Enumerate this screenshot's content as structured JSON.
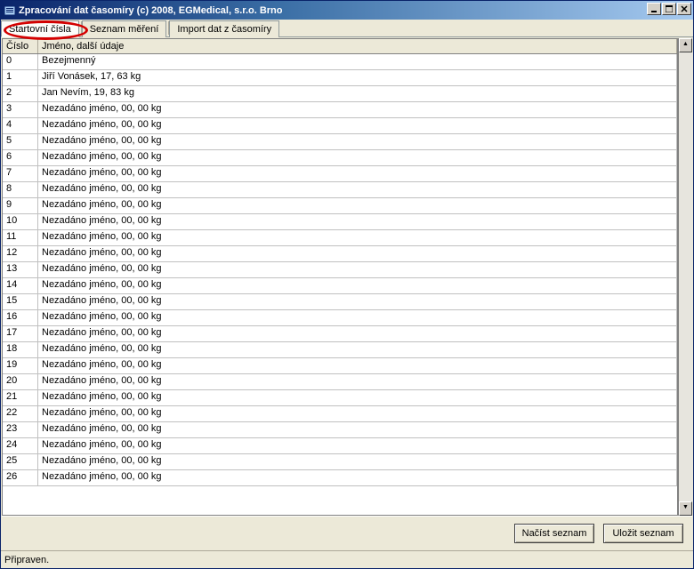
{
  "window": {
    "title": "Zpracování dat časomíry (c) 2008, EGMedical, s.r.o. Brno"
  },
  "tabs": [
    {
      "label": "Startovní čísla",
      "active": true
    },
    {
      "label": "Seznam měření",
      "active": false
    },
    {
      "label": "Import dat z časomíry",
      "active": false
    }
  ],
  "columns": [
    {
      "label": "Číslo"
    },
    {
      "label": "Jméno, další údaje"
    }
  ],
  "rows": [
    {
      "num": "0",
      "name": "Bezejmenný"
    },
    {
      "num": "1",
      "name": "Jiří Vonásek, 17, 63 kg"
    },
    {
      "num": "2",
      "name": "Jan Nevím, 19, 83 kg"
    },
    {
      "num": "3",
      "name": "Nezadáno jméno, 00, 00 kg"
    },
    {
      "num": "4",
      "name": "Nezadáno jméno, 00, 00 kg"
    },
    {
      "num": "5",
      "name": "Nezadáno jméno, 00, 00 kg"
    },
    {
      "num": "6",
      "name": "Nezadáno jméno, 00, 00 kg"
    },
    {
      "num": "7",
      "name": "Nezadáno jméno, 00, 00 kg"
    },
    {
      "num": "8",
      "name": "Nezadáno jméno, 00, 00 kg"
    },
    {
      "num": "9",
      "name": "Nezadáno jméno, 00, 00 kg"
    },
    {
      "num": "10",
      "name": "Nezadáno jméno, 00, 00 kg"
    },
    {
      "num": "11",
      "name": "Nezadáno jméno, 00, 00 kg"
    },
    {
      "num": "12",
      "name": "Nezadáno jméno, 00, 00 kg"
    },
    {
      "num": "13",
      "name": "Nezadáno jméno, 00, 00 kg"
    },
    {
      "num": "14",
      "name": "Nezadáno jméno, 00, 00 kg"
    },
    {
      "num": "15",
      "name": "Nezadáno jméno, 00, 00 kg"
    },
    {
      "num": "16",
      "name": "Nezadáno jméno, 00, 00 kg"
    },
    {
      "num": "17",
      "name": "Nezadáno jméno, 00, 00 kg"
    },
    {
      "num": "18",
      "name": "Nezadáno jméno, 00, 00 kg"
    },
    {
      "num": "19",
      "name": "Nezadáno jméno, 00, 00 kg"
    },
    {
      "num": "20",
      "name": "Nezadáno jméno, 00, 00 kg"
    },
    {
      "num": "21",
      "name": "Nezadáno jméno, 00, 00 kg"
    },
    {
      "num": "22",
      "name": "Nezadáno jméno, 00, 00 kg"
    },
    {
      "num": "23",
      "name": "Nezadáno jméno, 00, 00 kg"
    },
    {
      "num": "24",
      "name": "Nezadáno jméno, 00, 00 kg"
    },
    {
      "num": "25",
      "name": "Nezadáno jméno, 00, 00 kg"
    },
    {
      "num": "26",
      "name": "Nezadáno jméno, 00, 00 kg"
    }
  ],
  "buttons": {
    "load": "Načíst seznam",
    "save": "Uložit seznam"
  },
  "status": "Připraven."
}
